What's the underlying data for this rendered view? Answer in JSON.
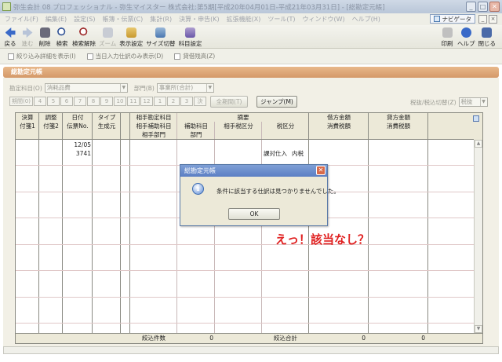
{
  "window": {
    "title": "弥生会計 08 プロフェッショナル - 弥生マイスター 株式会社:第5期[平成20年04月01日-平成21年03月31日] - [総勘定元帳]"
  },
  "menu": [
    "ファイル(F)",
    "編集(E)",
    "設定(S)",
    "帳簿・伝票(C)",
    "集計(R)",
    "決算・申告(K)",
    "拡張機能(X)",
    "ツール(T)",
    "ウィンドウ(W)",
    "ヘルプ(H)"
  ],
  "navigator": "ナビゲータ",
  "toolbar": {
    "items": [
      {
        "label": "戻る",
        "enabled": true
      },
      {
        "label": "進む",
        "enabled": false
      },
      {
        "label": "削除",
        "enabled": true
      },
      {
        "label": "検索",
        "enabled": true
      },
      {
        "label": "検索解除",
        "enabled": true
      },
      {
        "label": "ズーム",
        "enabled": false
      },
      {
        "label": "表示設定",
        "enabled": true
      },
      {
        "label": "サイズ切替",
        "enabled": true
      },
      {
        "label": "科目設定",
        "enabled": true
      }
    ],
    "right": [
      "印刷",
      "ヘルプ",
      "閉じる"
    ]
  },
  "options": [
    "絞り込み詳細を表示(I)",
    "当日入力仕訳のみ表示(D)",
    "貸借残高(Z)"
  ],
  "panel_title": "総勘定元帳",
  "filters": {
    "account_label": "勘定科目(O)",
    "account_value": "消耗品費",
    "dept_label": "部門(B)",
    "dept_value": "事業所(合計)"
  },
  "periods": [
    "期間(0)",
    "4",
    "5",
    "6",
    "7",
    "8",
    "9",
    "10",
    "11",
    "12",
    "1",
    "2",
    "3",
    "決"
  ],
  "all_period": "全期間(T)",
  "jump": "ジャンプ(M)",
  "tax": {
    "label": "税抜/税込切替(Z)",
    "value": "税抜"
  },
  "headers": {
    "c1a": "決算",
    "c1b": "付箋1",
    "c2a": "調整",
    "c2b": "付箋2",
    "c3a": "日付",
    "c3b": "伝票No.",
    "c4a": "タイプ",
    "c4b": "生成元",
    "c5a": "相手勘定科目",
    "c5b": "相手補助科目",
    "c5c": "相手部門",
    "c6a": "補助科目",
    "c6c": "部門",
    "c7a": "摘要",
    "c7b": "相手税区分",
    "c8": "税区分",
    "c9a": "借方金額",
    "c9b": "消費税額",
    "c10a": "貸方金額",
    "c10b": "消費税額"
  },
  "row": {
    "date": "12/05",
    "no": "3741",
    "tax1": "課対仕入",
    "tax2": "内税"
  },
  "summary": {
    "count_label": "絞込件数",
    "count": "0",
    "total_label": "絞込合計",
    "debit": "0",
    "credit": "0"
  },
  "dialog": {
    "title": "総勘定元帳",
    "message": "条件に該当する仕訳は見つかりませんでした。",
    "ok": "OK"
  },
  "annotation": "えっ！該当なし？"
}
